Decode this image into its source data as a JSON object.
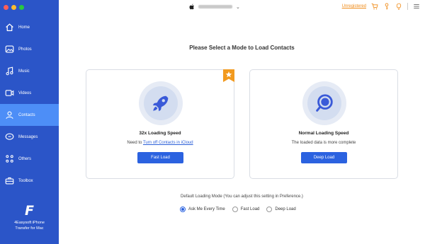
{
  "window": {
    "traffic_lights": [
      "close",
      "minimize",
      "zoom"
    ],
    "device_icon": "apple-icon",
    "device_name_redacted": true
  },
  "topbar": {
    "unregistered": "Unregistered",
    "icons": [
      "cart-icon",
      "key-icon",
      "lightbulb-icon",
      "menu-icon"
    ],
    "accent": "#ef8a16"
  },
  "sidebar": {
    "bg": "#2b55c8",
    "active_bg": "#4d8ef7",
    "items": [
      {
        "label": "Home",
        "icon": "home-icon"
      },
      {
        "label": "Photos",
        "icon": "photos-icon"
      },
      {
        "label": "Music",
        "icon": "music-icon"
      },
      {
        "label": "Videos",
        "icon": "videos-icon"
      },
      {
        "label": "Contacts",
        "icon": "contacts-icon",
        "active": true
      },
      {
        "label": "Messages",
        "icon": "messages-icon"
      },
      {
        "label": "Others",
        "icon": "others-icon"
      },
      {
        "label": "Toolbox",
        "icon": "toolbox-icon"
      }
    ],
    "brand_logo": "F",
    "brand_line1": "4Easysoft iPhone",
    "brand_line2": "Transfer for Mac"
  },
  "main": {
    "heading": "Please Select a Mode to Load Contacts",
    "fast": {
      "icon": "rocket-icon",
      "title": "32x Loading Speed",
      "desc_prefix": "Need to ",
      "desc_link": "Turn off Contacts in iCloud",
      "button": "Fast Load",
      "badge_icon": "star-icon"
    },
    "normal": {
      "icon": "search-icon",
      "title": "Normal Loading Speed",
      "desc": "The loaded data is more complete",
      "button": "Deep Load"
    },
    "default_label": "Default Loading Mode (You can adjust this setting in Preference.)",
    "options": [
      {
        "label": "Ask Me Every Time",
        "selected": true
      },
      {
        "label": "Fast Load",
        "selected": false
      },
      {
        "label": "Deep Load",
        "selected": false
      }
    ],
    "button_color": "#2b62e0"
  }
}
